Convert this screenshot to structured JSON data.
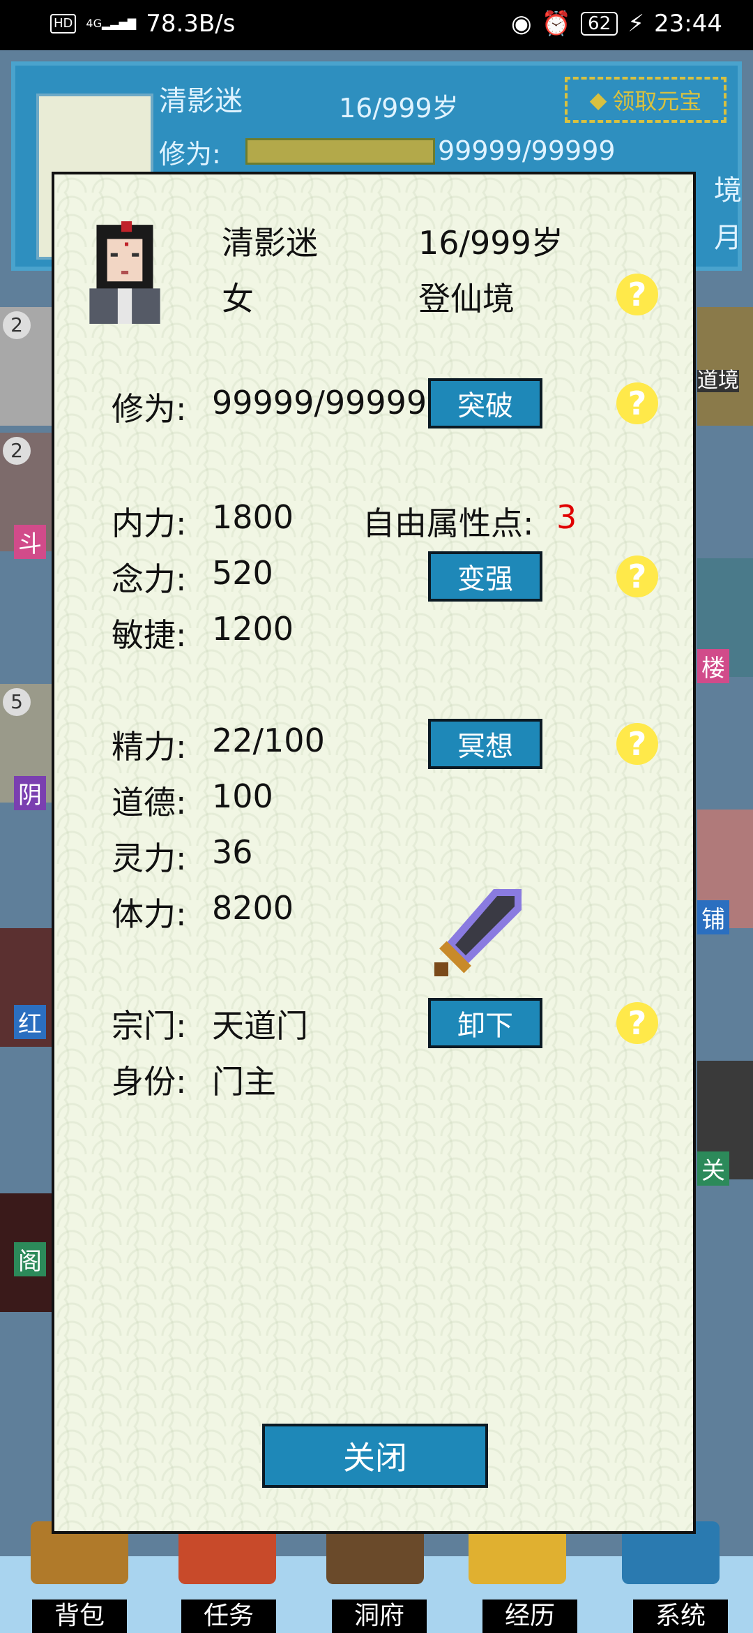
{
  "status_bar": {
    "hd": "HD",
    "signal": "4G",
    "net_speed": "78.3B/s",
    "battery": "62",
    "time": "23:44"
  },
  "background": {
    "name": "清影迷",
    "age": "16/999岁",
    "xiuwei_label": "修为:",
    "xiuwei_value": "99999/99999",
    "yuanbao_button": "领取元宝",
    "right_fragments": [
      "境",
      "月"
    ],
    "side_badges": [
      "2",
      "2",
      "5"
    ],
    "side_labels": [
      "斗",
      "阴",
      "红",
      "阁"
    ],
    "right_labels": [
      "道境",
      "楼",
      "铺",
      "关"
    ]
  },
  "modal": {
    "name": "清影迷",
    "age": "16/999岁",
    "gender": "女",
    "realm": "登仙境",
    "xiuwei_label": "修为:",
    "xiuwei_value": "99999/99999",
    "breakthrough_button": "突破",
    "neili_label": "内力:",
    "neili_value": "1800",
    "free_points_label": "自由属性点:",
    "free_points_value": "3",
    "nianli_label": "念力:",
    "nianli_value": "520",
    "strengthen_button": "变强",
    "minjie_label": "敏捷:",
    "minjie_value": "1200",
    "jingli_label": "精力:",
    "jingli_value": "22/100",
    "meditate_button": "冥想",
    "daode_label": "道德:",
    "daode_value": "100",
    "lingli_label": "灵力:",
    "lingli_value": "36",
    "tili_label": "体力:",
    "tili_value": "8200",
    "zongmen_label": "宗门:",
    "zongmen_value": "天道门",
    "unequip_button": "卸下",
    "shenfen_label": "身份:",
    "shenfen_value": "门主",
    "help_glyph": "?",
    "close_button": "关闭"
  },
  "bottom_nav": {
    "items": [
      "背包",
      "任务",
      "洞府",
      "经历",
      "系统"
    ]
  },
  "colors": {
    "accent_button": "#1e88b8",
    "panel_bg": "#f1f6e4",
    "help_yellow": "#ffe94a",
    "highlight_red": "#e00000"
  }
}
